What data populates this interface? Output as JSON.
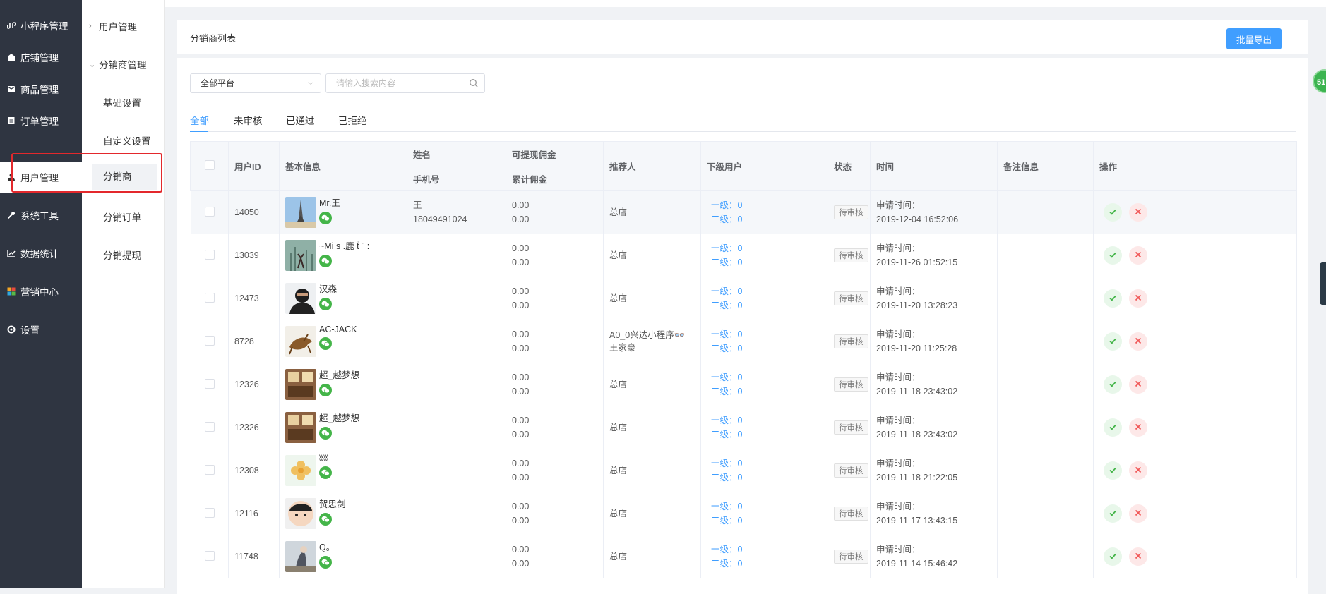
{
  "nav": {
    "items": [
      {
        "label": "小程序管理",
        "icon": "miniprogram-icon"
      },
      {
        "label": "店铺管理",
        "icon": "store-icon"
      },
      {
        "label": "商品管理",
        "icon": "goods-icon"
      },
      {
        "label": "订单管理",
        "icon": "order-icon"
      },
      {
        "label": "用户管理",
        "icon": "user-icon"
      },
      {
        "label": "系统工具",
        "icon": "wrench-icon"
      },
      {
        "label": "数据统计",
        "icon": "chart-icon"
      },
      {
        "label": "营销中心",
        "icon": "marketing-icon"
      },
      {
        "label": "设置",
        "icon": "gear-icon"
      }
    ]
  },
  "subnav": {
    "group1": "用户管理",
    "group2": "分销商管理",
    "items": [
      "基础设置",
      "自定义设置",
      "分销商",
      "分销订单",
      "分销提现"
    ]
  },
  "header": {
    "title": "分销商列表",
    "export_label": "批量导出"
  },
  "filters": {
    "platform": "全部平台",
    "search_placeholder": "请输入搜索内容"
  },
  "tabs": [
    "全部",
    "未审核",
    "已通过",
    "已拒绝"
  ],
  "table": {
    "headers": {
      "id": "用户ID",
      "basic": "基本信息",
      "name": "姓名",
      "phone": "手机号",
      "withdrawable": "可提现佣金",
      "total": "累计佣金",
      "referrer": "推荐人",
      "sub": "下级用户",
      "status": "状态",
      "time": "时间",
      "remark": "备注信息",
      "ops": "操作"
    },
    "rows": [
      {
        "id": "14050",
        "nickname": "Mr.王",
        "name": "王",
        "phone": "18049491024",
        "withdrawable": "0.00",
        "total": "0.00",
        "referrer": "总店",
        "level1": "一级：0",
        "level2": "二级：0",
        "status": "待审核",
        "time_label": "申请时间：",
        "time": "2019-12-04 16:52:06"
      },
      {
        "id": "13039",
        "nickname": "~Mi s .鹿 ẗ ¨ :",
        "name": "",
        "phone": "",
        "withdrawable": "0.00",
        "total": "0.00",
        "referrer": "总店",
        "level1": "一级：0",
        "level2": "二级：0",
        "status": "待审核",
        "time_label": "申请时间：",
        "time": "2019-11-26 01:52:15"
      },
      {
        "id": "12473",
        "nickname": "汉森",
        "name": "",
        "phone": "",
        "withdrawable": "0.00",
        "total": "0.00",
        "referrer": "总店",
        "level1": "一级：0",
        "level2": "二级：0",
        "status": "待审核",
        "time_label": "申请时间：",
        "time": "2019-11-20 13:28:23"
      },
      {
        "id": "8728",
        "nickname": "AC-JACK",
        "name": "",
        "phone": "",
        "withdrawable": "0.00",
        "total": "0.00",
        "referrer": "A0_0兴达小程序👓 王家豪",
        "level1": "一级：0",
        "level2": "二级：0",
        "status": "待审核",
        "time_label": "申请时间：",
        "time": "2019-11-20 11:25:28"
      },
      {
        "id": "12326",
        "nickname": "超_越梦想",
        "name": "",
        "phone": "",
        "withdrawable": "0.00",
        "total": "0.00",
        "referrer": "总店",
        "level1": "一级：0",
        "level2": "二级：0",
        "status": "待审核",
        "time_label": "申请时间：",
        "time": "2019-11-18 23:43:02"
      },
      {
        "id": "12326",
        "nickname": "超_越梦想",
        "name": "",
        "phone": "",
        "withdrawable": "0.00",
        "total": "0.00",
        "referrer": "总店",
        "level1": "一级：0",
        "level2": "二级：0",
        "status": "待审核",
        "time_label": "申请时间：",
        "time": "2019-11-18 23:43:02"
      },
      {
        "id": "12308",
        "nickname": "ʬʬ",
        "name": "",
        "phone": "",
        "withdrawable": "0.00",
        "total": "0.00",
        "referrer": "总店",
        "level1": "一级：0",
        "level2": "二级：0",
        "status": "待审核",
        "time_label": "申请时间：",
        "time": "2019-11-18 21:22:05"
      },
      {
        "id": "12116",
        "nickname": "贺思剑",
        "name": "",
        "phone": "",
        "withdrawable": "0.00",
        "total": "0.00",
        "referrer": "总店",
        "level1": "一级：0",
        "level2": "二级：0",
        "status": "待审核",
        "time_label": "申请时间：",
        "time": "2019-11-17 13:43:15"
      },
      {
        "id": "11748",
        "nickname": "Q。",
        "name": "",
        "phone": "",
        "withdrawable": "0.00",
        "total": "0.00",
        "referrer": "总店",
        "level1": "一级：0",
        "level2": "二级：0",
        "status": "待审核",
        "time_label": "申请时间：",
        "time": "2019-11-14 15:46:42"
      }
    ]
  },
  "float_badge": "51",
  "colors": {
    "accent": "#409eff",
    "nav_bg": "#2f3541",
    "highlight": "#e3282c",
    "wechat": "#44b549",
    "approve": "#44b549",
    "reject": "#f05656"
  }
}
